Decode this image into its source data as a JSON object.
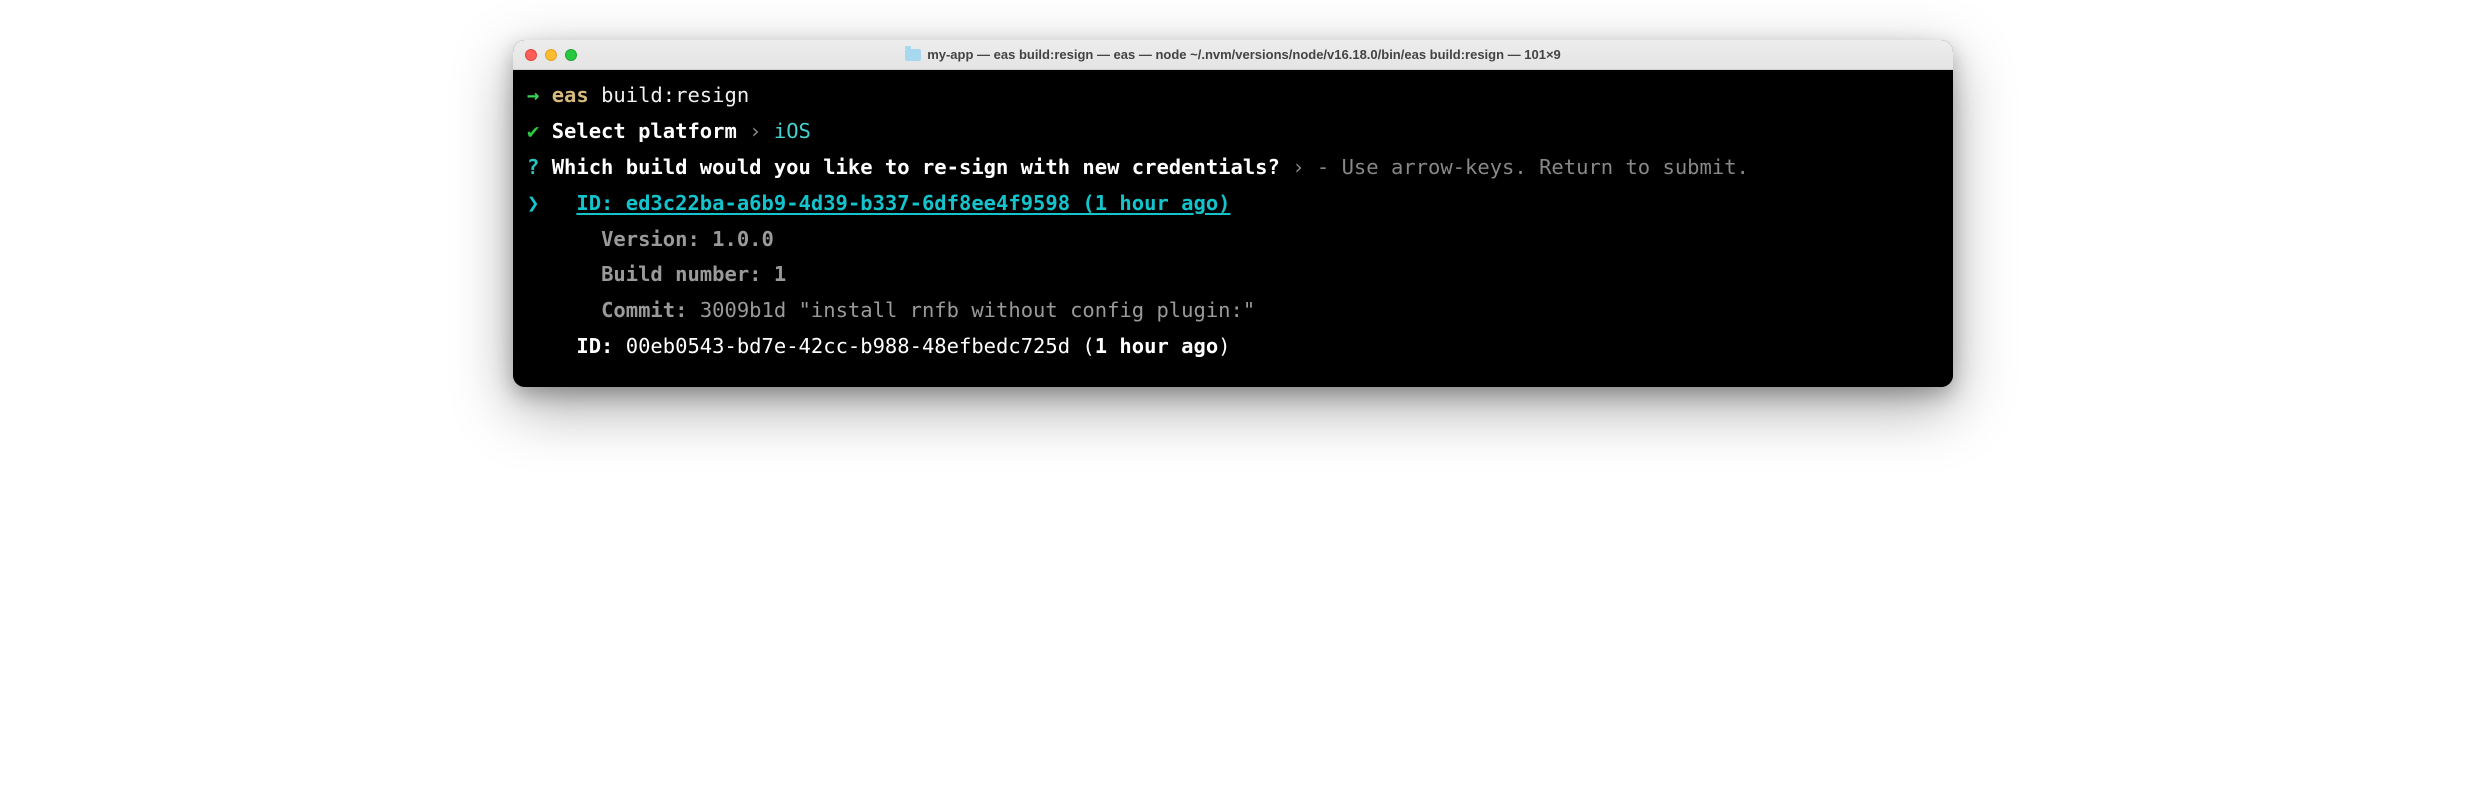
{
  "window": {
    "title": "my-app — eas build:resign — eas — node ~/.nvm/versions/node/v16.18.0/bin/eas build:resign — 101×9"
  },
  "prompt": {
    "arrow": "→",
    "cmd1": "eas",
    "cmd2": "build:resign"
  },
  "platform": {
    "check": "✔",
    "label": "Select platform",
    "chev": "›",
    "value": "iOS"
  },
  "question": {
    "mark": "?",
    "text": "Which build would you like to re-sign with new credentials?",
    "chev": "›",
    "hint": "- Use arrow-keys. Return to submit."
  },
  "selected": {
    "arrow": "❯",
    "text": "ID: ed3c22ba-a6b9-4d39-b337-6df8ee4f9598 (1 hour ago)",
    "version_label": "Version:",
    "version_value": "1.0.0",
    "buildnum_label": "Build number:",
    "buildnum_value": "1",
    "commit_label": "Commit:",
    "commit_value": "3009b1d \"install rnfb without config plugin:\""
  },
  "other": {
    "id_label": "ID:",
    "id_value": "00eb0543-bd7e-42cc-b988-48efbedc725d (",
    "time": "1 hour ago",
    "close": ")"
  }
}
